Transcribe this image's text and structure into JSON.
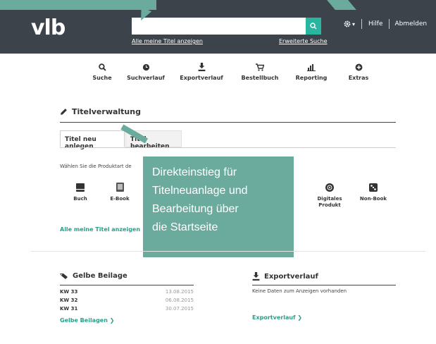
{
  "header": {
    "logo": "vlb",
    "search_placeholder": "",
    "my_titles_link": "Alle meine Titel anzeigen",
    "advanced_search_link": "Erweiterte Suche",
    "settings_caret": "▾",
    "help": "Hilfe",
    "logout": "Abmelden"
  },
  "nav": {
    "items": [
      {
        "label": "Suche",
        "icon": "search-icon"
      },
      {
        "label": "Suchverlauf",
        "icon": "history-icon"
      },
      {
        "label": "Exportverlauf",
        "icon": "export-icon"
      },
      {
        "label": "Bestellbuch",
        "icon": "cart-icon"
      },
      {
        "label": "Reporting",
        "icon": "bar-chart-icon"
      },
      {
        "label": "Extras",
        "icon": "plus-circle-icon"
      }
    ]
  },
  "titelverwaltung": {
    "title": "Titelverwaltung",
    "tabs": [
      "Titel neu anlegen",
      "Titel bearbeiten"
    ],
    "product_prompt": "Wählen Sie die Produktart de",
    "products": [
      {
        "label": "Buch",
        "icon": "book-icon"
      },
      {
        "label": "E-Book",
        "icon": "ebook-icon"
      },
      {
        "label": "Digitales Produkt",
        "label_line1": "Digitales",
        "label_line2": "Produkt",
        "icon": "disc-icon"
      },
      {
        "label": "Non-Book",
        "icon": "dice-icon"
      }
    ],
    "all_titles_link": "Alle meine Titel anzeigen"
  },
  "callout": {
    "lines": [
      "Direkteinstieg für",
      "Titelneuanlage und",
      "Bearbeitung über",
      "die Startseite"
    ]
  },
  "gelbe_beilage": {
    "title": "Gelbe Beilage",
    "rows": [
      {
        "week": "KW 33",
        "date": "13.08.2015"
      },
      {
        "week": "KW 32",
        "date": "06.08.2015"
      },
      {
        "week": "KW 31",
        "date": "30.07.2015"
      }
    ],
    "link": "Gelbe Beilagen ❯"
  },
  "exportverlauf": {
    "title": "Exportverlauf",
    "empty": "Keine Daten zum Anzeigen vorhanden",
    "link": "Exportverlauf ❯"
  },
  "colors": {
    "header_bg": "#3d434b",
    "accent": "#2ab5a0",
    "callout": "#6bab9e",
    "link": "#2a9f8a"
  }
}
